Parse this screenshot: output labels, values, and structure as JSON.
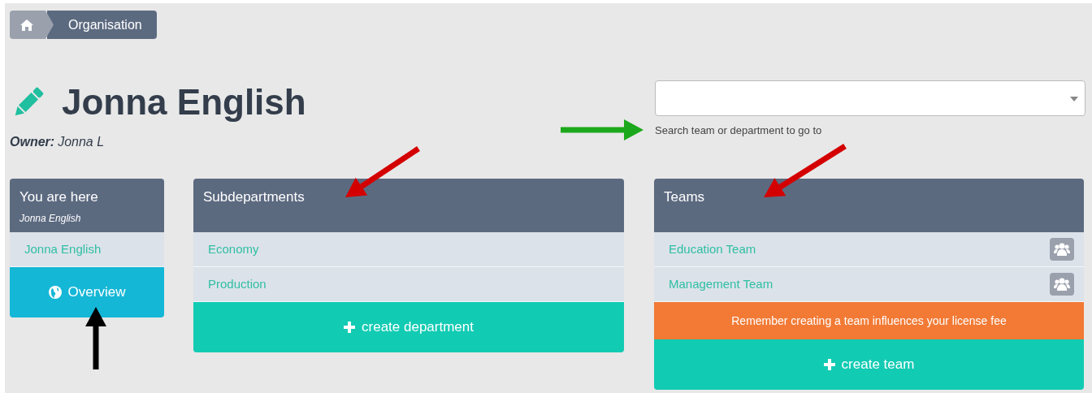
{
  "breadcrumb": {
    "items": [
      {
        "kind": "home"
      },
      {
        "kind": "text",
        "label": "Organisation"
      }
    ]
  },
  "page": {
    "title": "Jonna English",
    "owner_label": "Owner:",
    "owner": "Jonna L"
  },
  "search": {
    "hint": "Search team or department to go to"
  },
  "location_panel": {
    "title": "You are here",
    "subtitle": "Jonna English",
    "items": [
      "Jonna English"
    ],
    "button": "Overview"
  },
  "subdepartments": {
    "title": "Subdepartments",
    "items": [
      "Economy",
      "Production"
    ],
    "button": "create department"
  },
  "teams": {
    "title": "Teams",
    "items": [
      "Education Team",
      "Management Team"
    ],
    "notice": "Remember creating a team influences your license fee",
    "button": "create team"
  }
}
